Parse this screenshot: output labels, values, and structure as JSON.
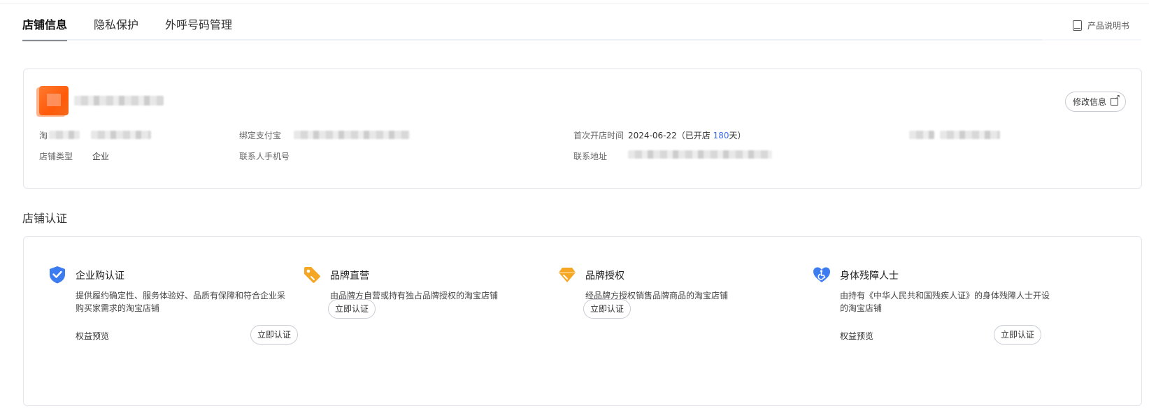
{
  "tabs": [
    {
      "label": "店铺信息",
      "active": true
    },
    {
      "label": "隐私保护",
      "active": false
    },
    {
      "label": "外呼号码管理",
      "active": false
    }
  ],
  "manual": {
    "label": "产品说明书",
    "icon": "book-icon"
  },
  "shop_info": {
    "edit_label": "修改信息",
    "fields": {
      "taobao_label": "淘",
      "bind_label": "绑定支付宝",
      "open_time_label": "首次开店时间",
      "open_time_value_prefix": "2024-06-22（已开店 ",
      "open_days": "180",
      "open_time_value_suffix": "天）",
      "type_label": "店铺类型",
      "type_value": "企业",
      "contact_phone_label": "联系人手机号",
      "address_label": "联系地址"
    }
  },
  "certification": {
    "title": "店铺认证",
    "items": [
      {
        "name": "企业购认证",
        "icon": "shield-check-icon",
        "color": "#3d7bf0",
        "desc": "提供履约确定性、服务体验好、品质有保障和符合企业采购买家需求的淘宝店铺",
        "rights": "权益预览",
        "button": "立即认证"
      },
      {
        "name": "品牌直营",
        "icon": "tag-icon",
        "color": "#f5a623",
        "desc": "由品牌方自营或持有独占品牌授权的淘宝店铺",
        "rights": "",
        "button": "立即认证"
      },
      {
        "name": "品牌授权",
        "icon": "diamond-icon",
        "color": "#f5a623",
        "desc": "经品牌方授权销售品牌商品的淘宝店铺",
        "rights": "",
        "button": "立即认证"
      },
      {
        "name": "身体残障人士",
        "icon": "heart-accessibility-icon",
        "color": "#3d7bf0",
        "desc": "由持有《中华人民共和国残疾人证》的身体残障人士开设的淘宝店铺",
        "rights": "权益预览",
        "button": "立即认证"
      }
    ]
  }
}
